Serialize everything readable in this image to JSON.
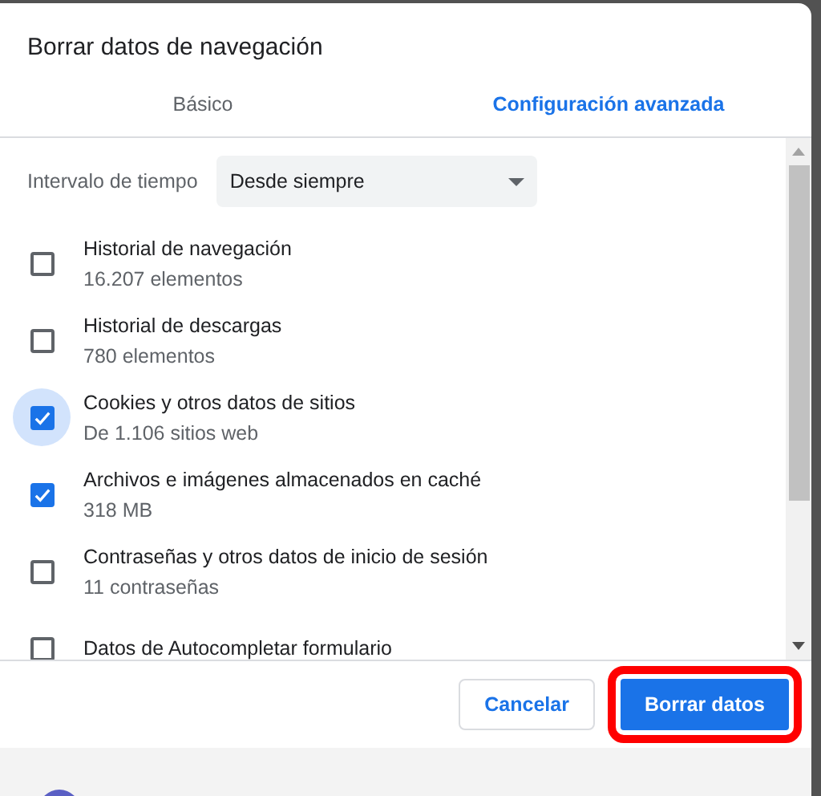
{
  "dialog": {
    "title": "Borrar datos de navegación"
  },
  "tabs": [
    {
      "label": "Básico",
      "selected": false
    },
    {
      "label": "Configuración avanzada",
      "selected": true
    }
  ],
  "time_range": {
    "label": "Intervalo de tiempo",
    "value": "Desde siempre"
  },
  "items": [
    {
      "label": "Historial de navegación",
      "detail": "16.207 elementos",
      "checked": false,
      "focused": false
    },
    {
      "label": "Historial de descargas",
      "detail": "780 elementos",
      "checked": false,
      "focused": false
    },
    {
      "label": "Cookies y otros datos de sitios",
      "detail": "De 1.106 sitios web",
      "checked": true,
      "focused": true
    },
    {
      "label": "Archivos e imágenes almacenados en caché",
      "detail": "318 MB",
      "checked": true,
      "focused": false
    },
    {
      "label": "Contraseñas y otros datos de inicio de sesión",
      "detail": "11 contraseñas",
      "checked": false,
      "focused": false
    },
    {
      "label": "Datos de Autocompletar formulario",
      "checked": false,
      "focused": false
    }
  ],
  "buttons": [
    {
      "label": "Cancelar",
      "kind": "secondary",
      "highlighted": false
    },
    {
      "label": "Borrar datos",
      "kind": "primary",
      "highlighted": true
    }
  ]
}
